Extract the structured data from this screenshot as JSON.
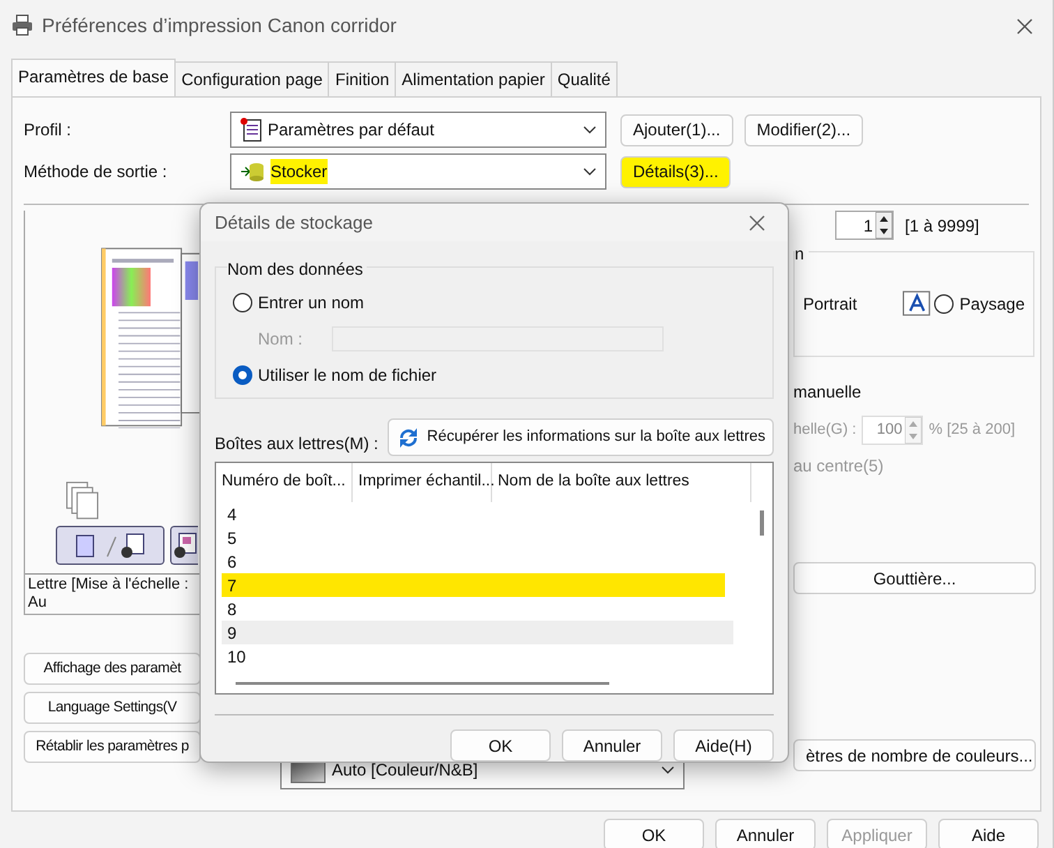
{
  "window": {
    "title": "Préférences d’impression Canon corridor"
  },
  "tabs": [
    {
      "label": "Paramètres de base",
      "selected": true
    },
    {
      "label": "Configuration page",
      "selected": false
    },
    {
      "label": "Finition",
      "selected": false
    },
    {
      "label": "Alimentation papier",
      "selected": false
    },
    {
      "label": "Qualité",
      "selected": false
    }
  ],
  "profile": {
    "label": "Profil :",
    "value": "Paramètres par défaut",
    "buttons": [
      "Ajouter(1)...",
      "Modifier(2)..."
    ]
  },
  "output_method": {
    "label": "Méthode de sortie :",
    "value": "Stocker",
    "highlighted": true,
    "button": {
      "label": "Détails(3)...",
      "highlighted": true
    }
  },
  "preview": {
    "caption": "Lettre [Mise à l'échelle : Au"
  },
  "left_buttons": [
    "Affichage des paramèt",
    "Language Settings(V",
    "Rétablir les paramètres p"
  ],
  "color_mode": {
    "value": "Auto [Couleur/N&B]"
  },
  "copies": {
    "value": "1",
    "range": "[1 à 9999]"
  },
  "orientation": {
    "legend": "n",
    "options": [
      {
        "label": "Portrait"
      },
      {
        "label": "Paysage",
        "selected": false
      }
    ]
  },
  "scaling": {
    "label": "manuelle",
    "scale_label": "helle(G) :",
    "scale_value": "100",
    "scale_range": "% [25 à 200]",
    "center_label": "au centre(5)"
  },
  "right_buttons": [
    "Gouttière...",
    "ètres de nombre de couleurs..."
  ],
  "footer_buttons": [
    {
      "label": "OK",
      "disabled": false
    },
    {
      "label": "Annuler",
      "disabled": false
    },
    {
      "label": "Appliquer",
      "disabled": true
    },
    {
      "label": "Aide",
      "disabled": false
    }
  ],
  "dialog": {
    "title": "Détails de stockage",
    "group": {
      "legend": "Nom des données",
      "options": [
        {
          "label": "Entrer un nom",
          "selected": false
        },
        {
          "label": "Utiliser le nom de fichier",
          "selected": true
        }
      ],
      "name_label": "Nom :"
    },
    "mailbox_label": "Boîtes aux lettres(M) :",
    "fetch_button": "Récupérer les informations sur la boîte aux lettres",
    "columns": [
      "Numéro de boît...",
      "Imprimer échantil...",
      "Nom de la boîte aux lettres"
    ],
    "rows": [
      {
        "number": "4",
        "selected": false,
        "hovered": false
      },
      {
        "number": "5",
        "selected": false,
        "hovered": false
      },
      {
        "number": "6",
        "selected": false,
        "hovered": false
      },
      {
        "number": "7",
        "selected": true,
        "hovered": false
      },
      {
        "number": "8",
        "selected": false,
        "hovered": false
      },
      {
        "number": "9",
        "selected": false,
        "hovered": true
      },
      {
        "number": "10",
        "selected": false,
        "hovered": false
      }
    ],
    "buttons": [
      "OK",
      "Annuler",
      "Aide(H)"
    ]
  }
}
